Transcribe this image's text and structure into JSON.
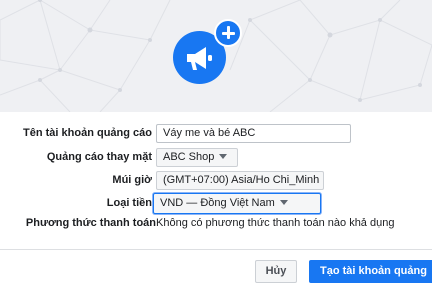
{
  "header": {
    "icon": "megaphone-icon",
    "badge_icon": "plus-icon",
    "brand_color": "#1877f2"
  },
  "form": {
    "account_name": {
      "label": "Tên tài khoản quảng cáo",
      "value": "Váy me và bé ABC"
    },
    "advertise_for": {
      "label": "Quảng cáo thay mặt",
      "value": "ABC Shop"
    },
    "timezone": {
      "label": "Múi giờ",
      "value": "(GMT+07:00) Asia/Ho Chi_Minh"
    },
    "currency": {
      "label": "Loại tiền",
      "value": "VND — Đồng Việt Nam"
    },
    "payment_method": {
      "label": "Phương thức thanh toán",
      "value": "Không có phương thức thanh toán nào khả dụng"
    }
  },
  "footer": {
    "cancel_label": "Hủy",
    "create_label": "Tạo tài khoản quảng"
  }
}
